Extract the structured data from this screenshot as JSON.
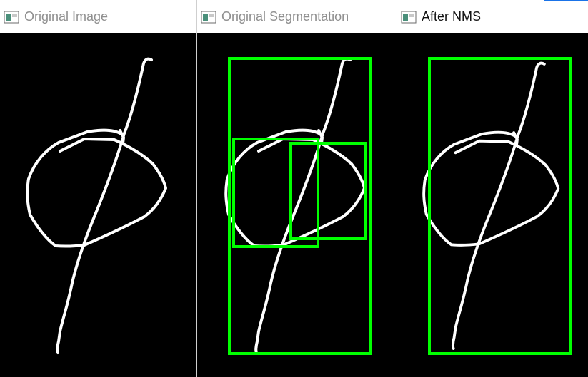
{
  "colors": {
    "box": "#00ff00",
    "stroke": "#ffffff",
    "title_inactive": "#8f8f8f",
    "title_active": "#111111"
  },
  "windows": [
    {
      "title": "Original Image",
      "active": false,
      "boxes": []
    },
    {
      "title": "Original Segmentation",
      "active": false,
      "boxes": [
        "full-glyph",
        "circle-left",
        "circle-right"
      ]
    },
    {
      "title": "After NMS",
      "active": true,
      "boxes": [
        "full-glyph"
      ]
    }
  ]
}
